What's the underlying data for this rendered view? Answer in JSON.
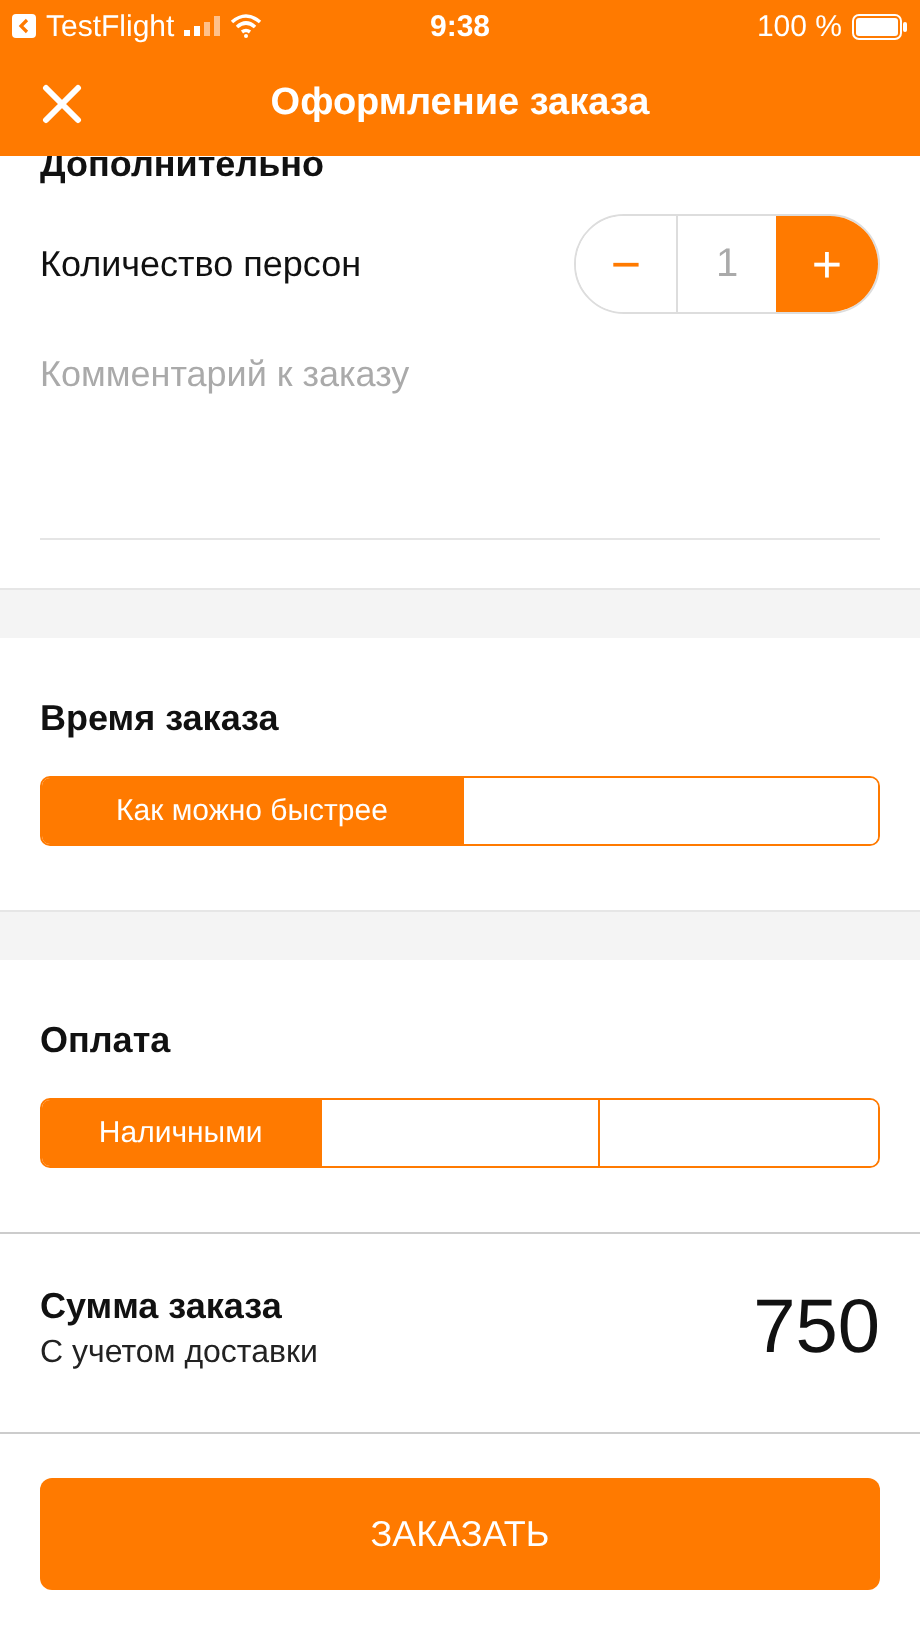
{
  "status_bar": {
    "back_app": "TestFlight",
    "time": "9:38",
    "battery": "100 %"
  },
  "nav": {
    "title": "Оформление заказа"
  },
  "extra": {
    "heading": "Дополнительно",
    "persons_label": "Количество персон",
    "minus": "−",
    "count": "1",
    "plus": "+",
    "comment_placeholder": "Комментарий к заказу"
  },
  "order_time": {
    "heading": "Время заказа",
    "segments": [
      {
        "label": "Как можно быстрее",
        "selected": true
      },
      {
        "selected": false
      }
    ]
  },
  "payment": {
    "heading": "Оплата",
    "segments": [
      {
        "label": "Наличными",
        "selected": true
      },
      {
        "selected": false
      },
      {
        "selected": false
      }
    ]
  },
  "total": {
    "title": "Сумма заказа",
    "subtitle": "С учетом доставки",
    "amount": "750"
  },
  "submit": "ЗАКАЗАТЬ"
}
